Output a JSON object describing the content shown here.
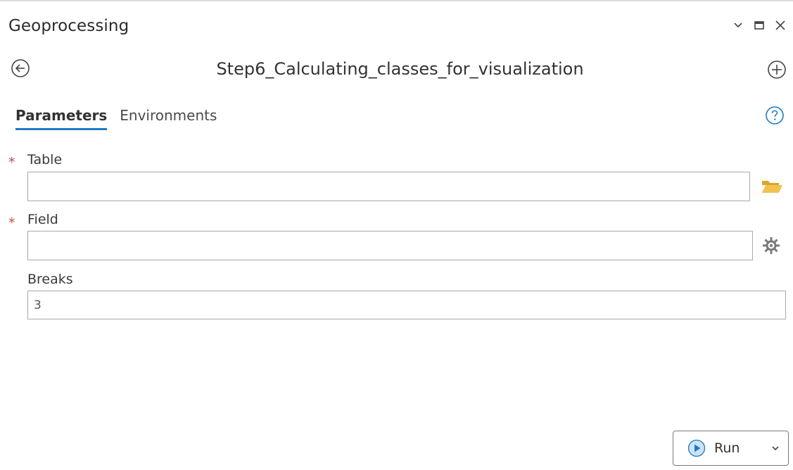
{
  "panel": {
    "title": "Geoprocessing",
    "tool_name": "Step6_Calculating_classes_for_visualization"
  },
  "tabs": [
    {
      "label": "Parameters",
      "active": true
    },
    {
      "label": "Environments",
      "active": false
    }
  ],
  "parameters": {
    "table": {
      "label": "Table",
      "required": true,
      "value": ""
    },
    "field": {
      "label": "Field",
      "required": true,
      "value": ""
    },
    "breaks": {
      "label": "Breaks",
      "required": false,
      "value": "3"
    }
  },
  "required_marker": "*",
  "run_button": {
    "label": "Run"
  },
  "icons": {
    "window_menu": "chevron-down-icon",
    "maximize": "maximize-icon",
    "close": "close-icon",
    "back": "back-arrow-icon",
    "add": "add-plus-icon",
    "help": "help-question-icon",
    "browse": "folder-icon",
    "field_settings": "gear-icon",
    "run": "play-icon"
  },
  "colors": {
    "accent": "#1d7bc4",
    "required": "#c0504d",
    "folder": "#f2c14e"
  }
}
